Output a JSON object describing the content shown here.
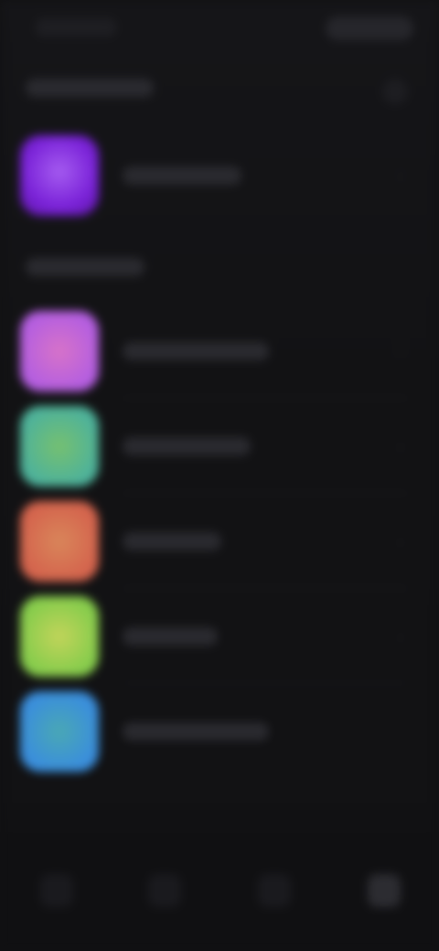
{
  "accent_colors": {
    "background": "#111113",
    "featured_icon": "#8a35e8",
    "icon_pink": "#c162d8",
    "icon_green": "#58b98c",
    "icon_orange": "#d87052",
    "icon_lime": "#9cd452",
    "icon_blue": "#3aa0d8"
  },
  "sections": [
    {
      "icon_names": [
        "featured-app-icon"
      ]
    },
    {
      "icon_names": [
        "pink-app-icon",
        "green-app-icon",
        "orange-app-icon",
        "lime-app-icon",
        "blue-app-icon"
      ]
    }
  ],
  "tab_bar": {
    "icon_names": [
      "tab-1-icon",
      "tab-2-icon",
      "tab-3-icon",
      "tab-4-icon"
    ]
  }
}
